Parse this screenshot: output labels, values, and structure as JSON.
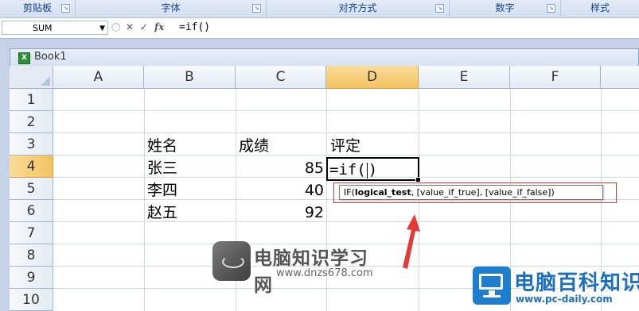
{
  "ribbon": {
    "groups": [
      {
        "label": "剪贴板"
      },
      {
        "label": "字体"
      },
      {
        "label": "对齐方式"
      },
      {
        "label": "数字"
      },
      {
        "label": "样式"
      }
    ]
  },
  "formula_bar": {
    "name_box": "SUM",
    "cancel_icon": "✕",
    "enter_icon": "✓",
    "fx_label": "fx",
    "formula": "=if()"
  },
  "workbook": {
    "title": "Book1"
  },
  "columns": [
    "A",
    "B",
    "C",
    "D",
    "E",
    "F"
  ],
  "rows": [
    "1",
    "2",
    "3",
    "4",
    "5",
    "6",
    "7",
    "8",
    "9",
    "10"
  ],
  "selected_column": "D",
  "selected_row": "4",
  "cells": {
    "B3": "姓名",
    "C3": "成绩",
    "D3": "评定",
    "B4": "张三",
    "C4": "85",
    "B5": "李四",
    "C5": "40",
    "B6": "赵五",
    "C6": "92"
  },
  "editing": {
    "prefix": "=if(",
    "suffix": ")"
  },
  "tooltip": {
    "func": "IF(",
    "bold_arg": "logical_test",
    "rest": ", [value_if_true], [value_if_false])"
  },
  "watermarks": {
    "left_title": "电脑知识学习网",
    "left_url": "www.dnzs678.com",
    "right_title": "电脑百科知识",
    "right_url": "www.pc-daily.com"
  },
  "colors": {
    "annotation_red": "#e53935",
    "selected_header": "#f3c25f"
  }
}
